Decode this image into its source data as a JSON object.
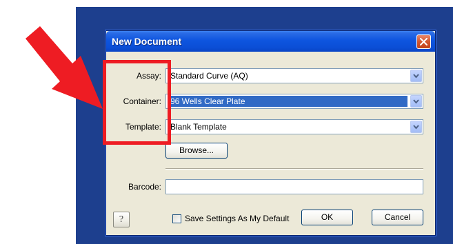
{
  "dialog": {
    "title": "New Document",
    "fields": {
      "assay": {
        "label": "Assay:",
        "value": "Standard Curve (AQ)"
      },
      "container": {
        "label": "Container:",
        "value": "96 Wells Clear Plate"
      },
      "template": {
        "label": "Template:",
        "value": "Blank Template"
      }
    },
    "browse_label": "Browse...",
    "barcode": {
      "label": "Barcode:",
      "value": ""
    },
    "help_label": "?",
    "save_default_label": "Save Settings As My Default",
    "save_default_checked": false,
    "ok_label": "OK",
    "cancel_label": "Cancel"
  },
  "colors": {
    "desktop_background": "#1d3f8e",
    "titlebar": "#0b4ed6",
    "selection": "#316ac5",
    "annotation": "#ee1c23"
  },
  "icons": [
    "close-icon",
    "chevron-down-icon",
    "help-icon",
    "annotation-arrow"
  ]
}
